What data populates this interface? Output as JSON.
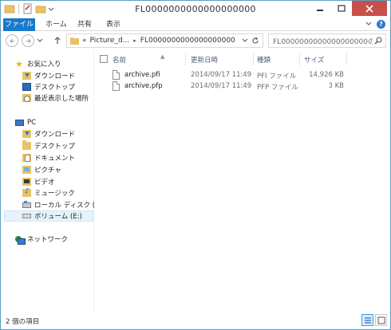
{
  "window": {
    "title": "FL0000000000000000000"
  },
  "ribbon": {
    "tabs": [
      {
        "label": "ファイル"
      },
      {
        "label": "ホーム"
      },
      {
        "label": "共有"
      },
      {
        "label": "表示"
      }
    ],
    "help": "?"
  },
  "address": {
    "prefix": "«",
    "crumbs": [
      "Picture_d...",
      "FL0000000000000000000"
    ],
    "refresh_icon": "refresh-icon"
  },
  "search": {
    "placeholder": "FL0000000000000000000の..."
  },
  "nav": {
    "favorites": {
      "label": "お気に入り",
      "items": [
        {
          "label": "ダウンロード"
        },
        {
          "label": "デスクトップ"
        },
        {
          "label": "最近表示した場所"
        }
      ]
    },
    "pc": {
      "label": "PC",
      "items": [
        {
          "label": "ダウンロード"
        },
        {
          "label": "デスクトップ"
        },
        {
          "label": "ドキュメント"
        },
        {
          "label": "ピクチャ"
        },
        {
          "label": "ビデオ"
        },
        {
          "label": "ミュージック"
        },
        {
          "label": "ローカル ディスク (C:)"
        },
        {
          "label": "ボリューム (E:)"
        }
      ]
    },
    "network": {
      "label": "ネットワーク"
    }
  },
  "columns": {
    "name": "名前",
    "date": "更新日時",
    "type": "種類",
    "size": "サイズ"
  },
  "files": [
    {
      "name": "archive.pfi",
      "date": "2014/09/17 11:49",
      "type": "PFI ファイル",
      "size": "14,926 KB"
    },
    {
      "name": "archive.pfp",
      "date": "2014/09/17 11:49",
      "type": "PFP ファイル",
      "size": "3 KB"
    }
  ],
  "status": {
    "count": "2 個の項目"
  },
  "colors": {
    "file_tab": "#1979ca",
    "close_button": "#c7504a",
    "selection": "#e5f3fb",
    "folder": "#e8c265"
  }
}
